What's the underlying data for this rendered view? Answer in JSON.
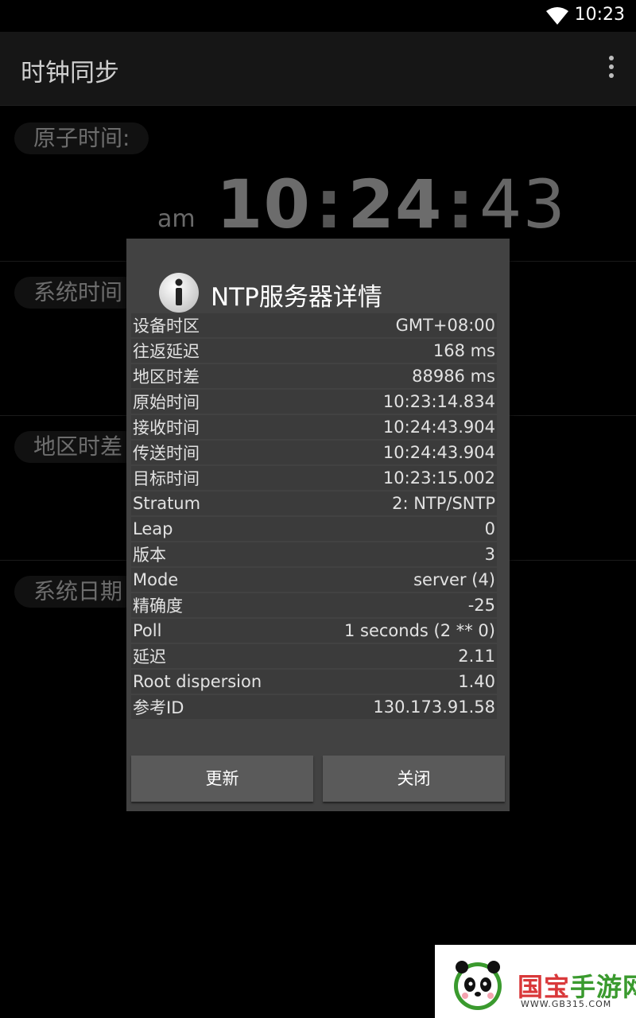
{
  "status_bar": {
    "time": "10:23",
    "icons": [
      "wifi-icon"
    ]
  },
  "app_bar": {
    "title": "时钟同步",
    "menu_icon": "overflow-menu-icon"
  },
  "background": {
    "atomic_label": "原子时间:",
    "am": "am",
    "clock_h": "10",
    "clock_m": "24",
    "clock_s": "43",
    "system_time_label": "系统时间",
    "region_diff_label": "地区时差",
    "system_date_label": "系统日期"
  },
  "dialog": {
    "icon": "info-icon",
    "title": "NTP服务器详情",
    "rows": [
      {
        "label": "设备时区",
        "value": "GMT+08:00"
      },
      {
        "label": "往返延迟",
        "value": "168 ms"
      },
      {
        "label": "地区时差",
        "value": "88986 ms"
      },
      {
        "label": "原始时间",
        "value": "10:23:14.834"
      },
      {
        "label": "接收时间",
        "value": "10:24:43.904"
      },
      {
        "label": "传送时间",
        "value": "10:24:43.904"
      },
      {
        "label": "目标时间",
        "value": "10:23:15.002"
      },
      {
        "label": "Stratum",
        "value": "2: NTP/SNTP"
      },
      {
        "label": "Leap",
        "value": "0"
      },
      {
        "label": "版本",
        "value": "3"
      },
      {
        "label": "Mode",
        "value": "server (4)"
      },
      {
        "label": "精确度",
        "value": "-25"
      },
      {
        "label": "Poll",
        "value": "1 seconds (2 ** 0)"
      },
      {
        "label": "延迟",
        "value": "2.11"
      },
      {
        "label": "Root dispersion",
        "value": "1.40"
      },
      {
        "label": "参考ID",
        "value": "130.173.91.58"
      }
    ],
    "update_button": "更新",
    "close_button": "关闭"
  },
  "watermark": {
    "text_red": "国宝",
    "text_green": "手游网",
    "url": "WWW.GB315.COM"
  },
  "colors": {
    "dialog_bg": "#424242",
    "button_bg": "#5a5a5a",
    "watermark_green": "#3a9a2e",
    "watermark_red": "#d9383a"
  }
}
